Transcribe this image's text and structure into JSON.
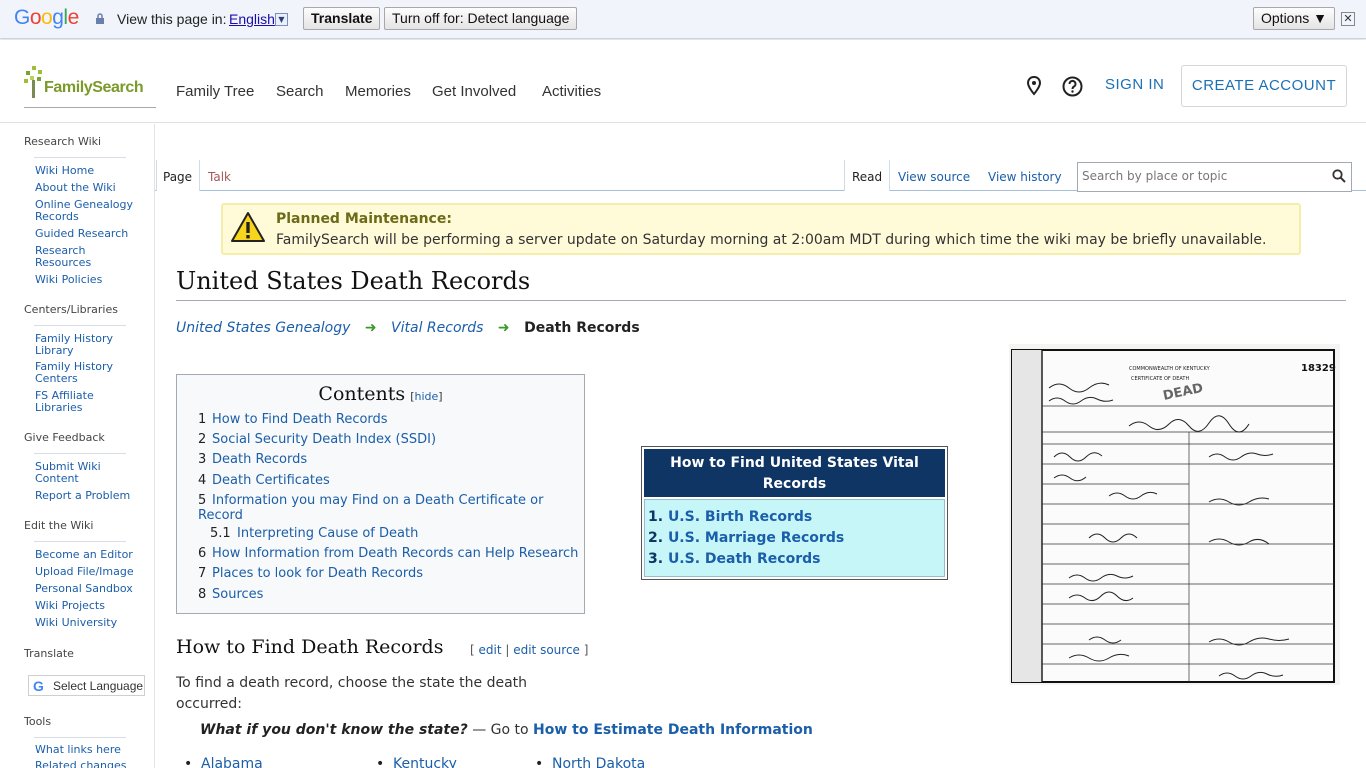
{
  "translate_bar": {
    "logo": "Google",
    "view_label": "View this page in:",
    "language": "English",
    "translate_button": "Translate",
    "turnoff_button": "Turn off for: Detect language",
    "options_button": "Options ▼",
    "close_label": "✕"
  },
  "header": {
    "logo_text": "FamilySearch",
    "nav": [
      "Family Tree",
      "Search",
      "Memories",
      "Get Involved",
      "Activities"
    ],
    "sign_in": "SIGN IN",
    "create_account": "CREATE ACCOUNT"
  },
  "sidebar": {
    "sections": [
      {
        "heading": "Research Wiki",
        "items": [
          "Wiki Home",
          "About the Wiki",
          "Online Genealogy Records",
          "Guided Research",
          "Research Resources",
          "Wiki Policies"
        ]
      },
      {
        "heading": "Centers/Libraries",
        "items": [
          "Family History Library",
          "Family History Centers",
          "FS Affiliate Libraries"
        ]
      },
      {
        "heading": "Give Feedback",
        "items": [
          "Submit Wiki Content",
          "Report a Problem"
        ]
      },
      {
        "heading": "Edit the Wiki",
        "items": [
          "Become an Editor",
          "Upload File/Image",
          "Personal Sandbox",
          "Wiki Projects",
          "Wiki University"
        ]
      },
      {
        "heading": "Translate",
        "items": []
      },
      {
        "heading": "Tools",
        "items": [
          "What links here",
          "Related changes"
        ]
      }
    ],
    "translate_widget": "Select Language"
  },
  "tabs": {
    "page": "Page",
    "talk": "Talk",
    "read": "Read",
    "view_source": "View source",
    "view_history": "View history"
  },
  "search": {
    "placeholder": "Search by place or topic"
  },
  "notice": {
    "title": "Planned Maintenance:",
    "message": "FamilySearch will be performing a server update on Saturday morning at 2:00am MDT during which time the wiki may be briefly unavailable."
  },
  "page_title": "United States Death Records",
  "breadcrumb": {
    "items": [
      "United States Genealogy",
      "Vital Records"
    ],
    "current": "Death Records"
  },
  "toc": {
    "title": "Contents",
    "hide": "hide",
    "items": [
      {
        "num": "1",
        "text": "How to Find Death Records"
      },
      {
        "num": "2",
        "text": "Social Security Death Index (SSDI)"
      },
      {
        "num": "3",
        "text": "Death Records"
      },
      {
        "num": "4",
        "text": "Death Certificates"
      },
      {
        "num": "5",
        "text": "Information you may Find on a Death Certificate or Record"
      },
      {
        "num": "5.1",
        "text": "Interpreting Cause of Death"
      },
      {
        "num": "6",
        "text": "How Information from Death Records can Help Research"
      },
      {
        "num": "7",
        "text": "Places to look for Death Records"
      },
      {
        "num": "8",
        "text": "Sources"
      }
    ]
  },
  "vital_box": {
    "title": "How to Find United States Vital Records",
    "items": [
      {
        "num": "1.",
        "text": "U.S. Birth Records"
      },
      {
        "num": "2.",
        "text": "U.S. Marriage Records"
      },
      {
        "num": "3.",
        "text": "U.S. Death Records"
      }
    ]
  },
  "certificate": {
    "number": "18329",
    "state": "COMMONWEALTH OF KENTUCKY",
    "type": "CERTIFICATE OF DEATH"
  },
  "section": {
    "heading": "How to Find Death Records",
    "edit": "edit",
    "edit_source": "edit source",
    "intro": "To find a death record, choose the state the death occurred:",
    "question": "What if you don't know the state?",
    "goto": " — Go to ",
    "estimate_link": "How to Estimate Death Information"
  },
  "states": [
    "Alabama",
    "Kentucky",
    "North Dakota"
  ]
}
